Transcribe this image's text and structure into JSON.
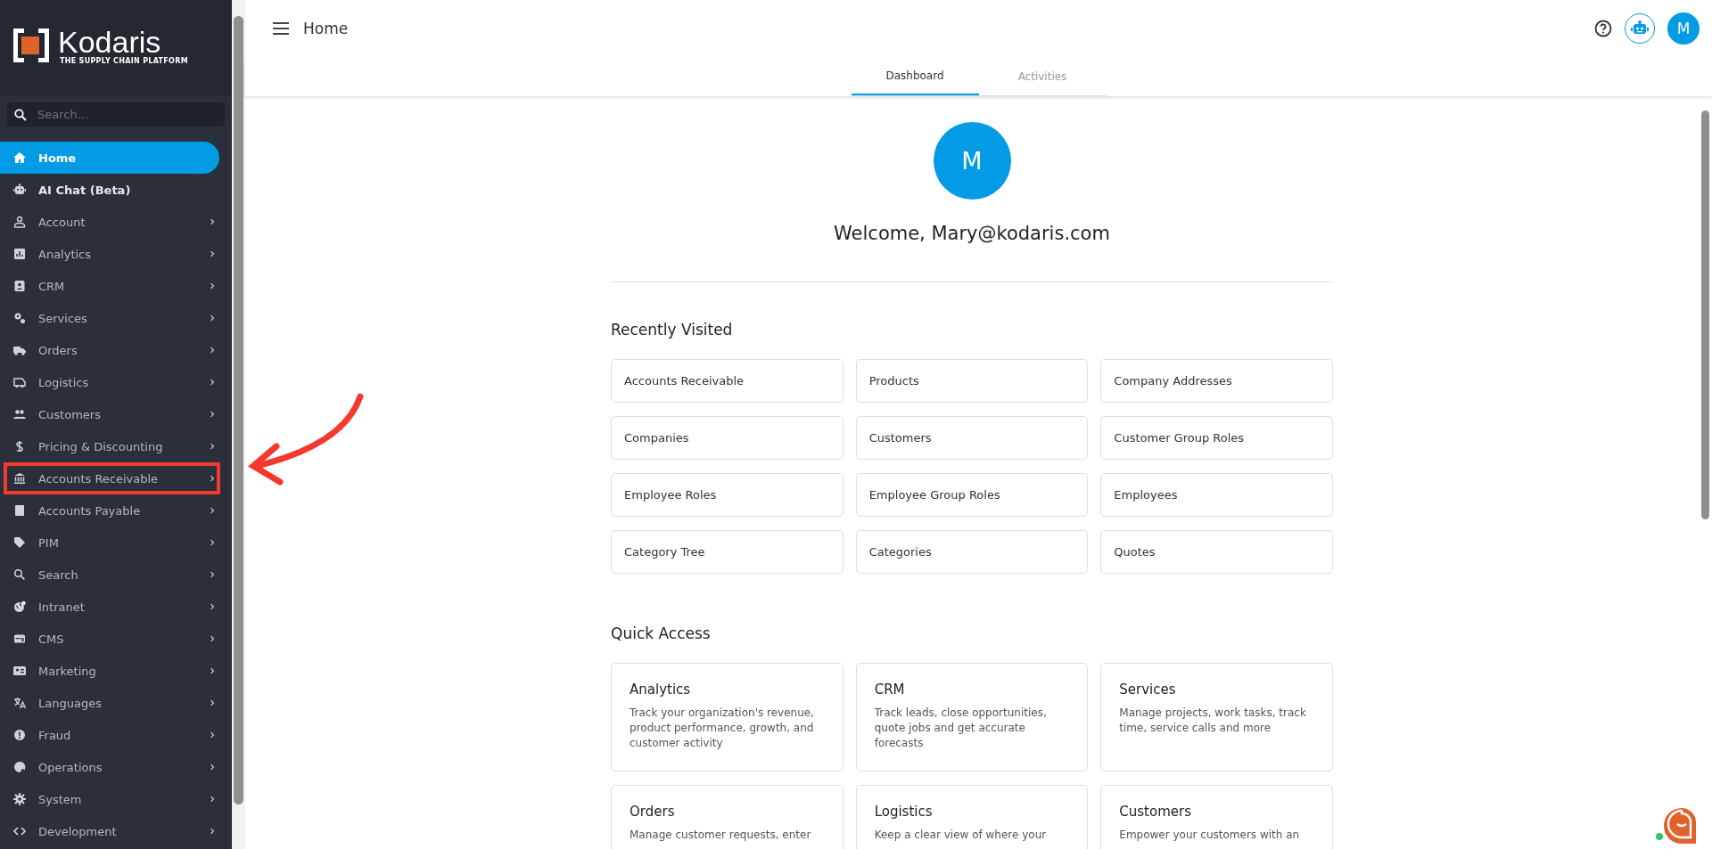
{
  "sidebar": {
    "logo": {
      "name": "Kodaris",
      "tagline": "THE SUPPLY CHAIN PLATFORM"
    },
    "search": {
      "placeholder": "Search..."
    },
    "items": [
      {
        "label": "Home",
        "kind": "link",
        "selected": true,
        "highlighted": false
      },
      {
        "label": "AI Chat (Beta)",
        "kind": "link",
        "selected": false,
        "highlighted": false
      },
      {
        "label": "Account",
        "kind": "menu",
        "selected": false,
        "highlighted": false
      },
      {
        "label": "Analytics",
        "kind": "menu",
        "selected": false,
        "highlighted": false
      },
      {
        "label": "CRM",
        "kind": "menu",
        "selected": false,
        "highlighted": false
      },
      {
        "label": "Services",
        "kind": "menu",
        "selected": false,
        "highlighted": false
      },
      {
        "label": "Orders",
        "kind": "menu",
        "selected": false,
        "highlighted": false
      },
      {
        "label": "Logistics",
        "kind": "menu",
        "selected": false,
        "highlighted": false
      },
      {
        "label": "Customers",
        "kind": "menu",
        "selected": false,
        "highlighted": false
      },
      {
        "label": "Pricing & Discounting",
        "kind": "menu",
        "selected": false,
        "highlighted": false
      },
      {
        "label": "Accounts Receivable",
        "kind": "menu",
        "selected": false,
        "highlighted": true
      },
      {
        "label": "Accounts Payable",
        "kind": "menu",
        "selected": false,
        "highlighted": false
      },
      {
        "label": "PIM",
        "kind": "menu",
        "selected": false,
        "highlighted": false
      },
      {
        "label": "Search",
        "kind": "menu",
        "selected": false,
        "highlighted": false
      },
      {
        "label": "Intranet",
        "kind": "menu",
        "selected": false,
        "highlighted": false
      },
      {
        "label": "CMS",
        "kind": "menu",
        "selected": false,
        "highlighted": false
      },
      {
        "label": "Marketing",
        "kind": "menu",
        "selected": false,
        "highlighted": false
      },
      {
        "label": "Languages",
        "kind": "menu",
        "selected": false,
        "highlighted": false
      },
      {
        "label": "Fraud",
        "kind": "menu",
        "selected": false,
        "highlighted": false
      },
      {
        "label": "Operations",
        "kind": "menu",
        "selected": false,
        "highlighted": false
      },
      {
        "label": "System",
        "kind": "menu",
        "selected": false,
        "highlighted": false
      },
      {
        "label": "Development",
        "kind": "menu",
        "selected": false,
        "highlighted": false
      }
    ]
  },
  "header": {
    "title": "Home",
    "user_initial": "M"
  },
  "tabs": [
    {
      "label": "Dashboard",
      "selected": true
    },
    {
      "label": "Activities",
      "selected": false
    }
  ],
  "welcome": {
    "initial": "M",
    "text": "Welcome, Mary@kodaris.com"
  },
  "recently_visited": {
    "title": "Recently Visited",
    "items": [
      "Accounts Receivable",
      "Products",
      "Company Addresses",
      "Companies",
      "Customers",
      "Customer Group Roles",
      "Employee Roles",
      "Employee Group Roles",
      "Employees",
      "Category Tree",
      "Categories",
      "Quotes"
    ]
  },
  "quick_access": {
    "title": "Quick Access",
    "items": [
      {
        "title": "Analytics",
        "description": "Track your organization's revenue, product performance, growth, and customer activity"
      },
      {
        "title": "CRM",
        "description": "Track leads, close opportunities, quote jobs and get accurate forecasts"
      },
      {
        "title": "Services",
        "description": "Manage projects, work tasks, track time, service calls and more"
      },
      {
        "title": "Orders",
        "description": "Manage customer requests, enter"
      },
      {
        "title": "Logistics",
        "description": "Keep a clear view of where your"
      },
      {
        "title": "Customers",
        "description": "Empower your customers with an"
      }
    ]
  }
}
